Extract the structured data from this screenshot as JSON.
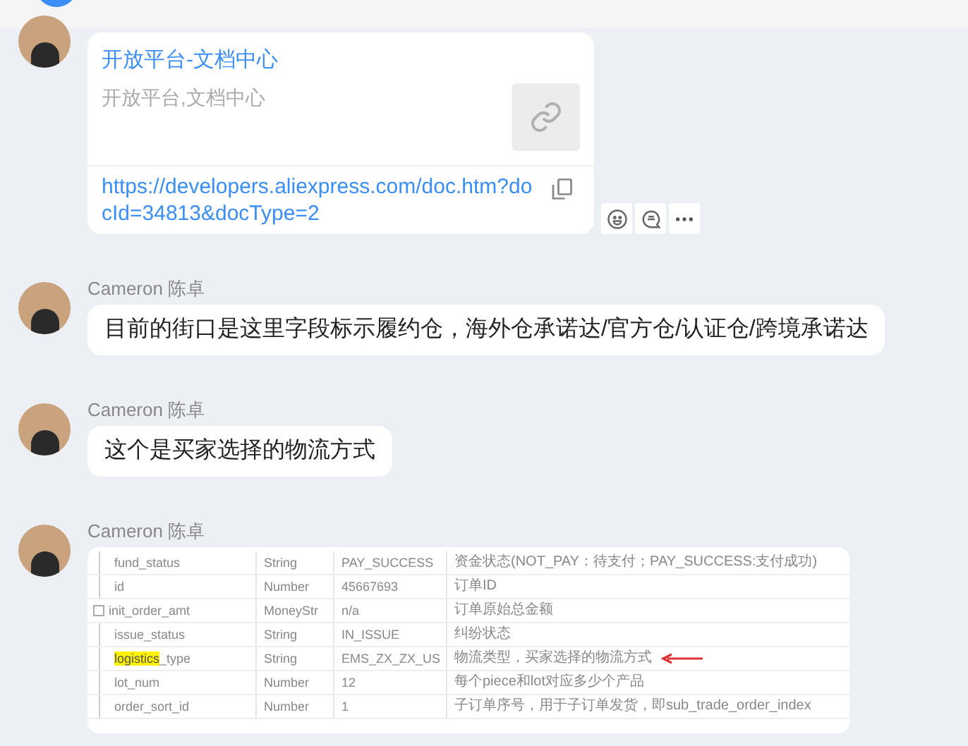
{
  "messages": [
    {
      "kind": "link_card",
      "title": "开放平台-文档中心",
      "subtitle": "开放平台,文档中心",
      "url": "https://developers.aliexpress.com/doc.htm?docId=34813&docType=2"
    },
    {
      "kind": "text",
      "sender": "Cameron 陈卓",
      "text": "目前的街口是这里字段标示履约仓，海外仓承诺达/官方仓/认证仓/跨境承诺达"
    },
    {
      "kind": "text",
      "sender": "Cameron 陈卓",
      "text": "这个是买家选择的物流方式"
    },
    {
      "kind": "table_image",
      "sender": "Cameron 陈卓",
      "rows": [
        {
          "name": [
            {
              "text": "fund_status",
              "highlighted": false
            }
          ],
          "expandable": false,
          "type": "String",
          "value": "PAY_SUCCESS",
          "description": "资金状态(NOT_PAY：待支付；PAY_SUCCESS:支付成功)",
          "arrow": false
        },
        {
          "name": [
            {
              "text": "id",
              "highlighted": false
            }
          ],
          "expandable": false,
          "type": "Number",
          "value": "45667693",
          "description": "订单ID",
          "arrow": false
        },
        {
          "name": [
            {
              "text": "init_order_amt",
              "highlighted": false
            }
          ],
          "expandable": true,
          "type": "MoneyStr",
          "value": "n/a",
          "description": "订单原始总金额",
          "arrow": false
        },
        {
          "name": [
            {
              "text": "issue_status",
              "highlighted": false
            }
          ],
          "expandable": false,
          "type": "String",
          "value": "IN_ISSUE",
          "description": "纠纷状态",
          "arrow": false
        },
        {
          "name": [
            {
              "text": "logistics",
              "highlighted": true
            },
            {
              "text": "_type",
              "highlighted": false
            }
          ],
          "expandable": false,
          "type": "String",
          "value": "EMS_ZX_ZX_US",
          "description": "物流类型，买家选择的物流方式",
          "arrow": true
        },
        {
          "name": [
            {
              "text": "lot_num",
              "highlighted": false
            }
          ],
          "expandable": false,
          "type": "Number",
          "value": "12",
          "description": "每个piece和lot对应多少个产品",
          "arrow": false
        },
        {
          "name": [
            {
              "text": "order_sort_id",
              "highlighted": false
            }
          ],
          "expandable": false,
          "type": "Number",
          "value": "1",
          "description": "子订单序号，用于子订单发货，即sub_trade_order_index",
          "arrow": false
        }
      ]
    }
  ]
}
